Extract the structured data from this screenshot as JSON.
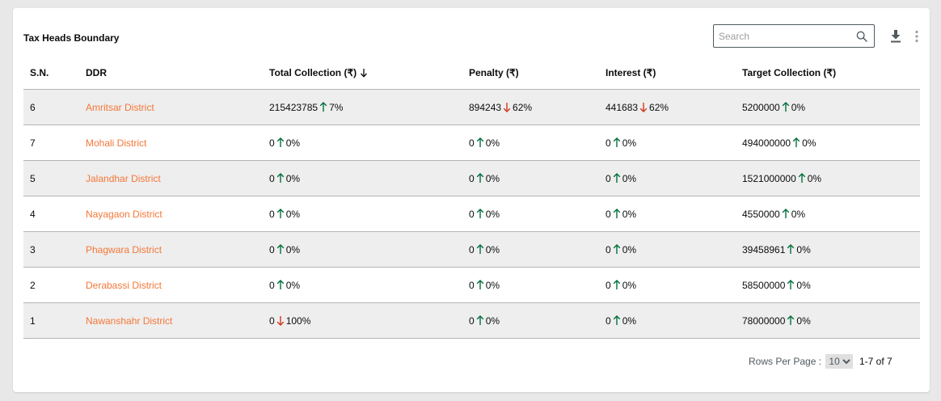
{
  "card": {
    "title": "Tax Heads Boundary",
    "search_placeholder": "Search",
    "icons": [
      "search-icon",
      "download-icon",
      "more-vertical-icon"
    ]
  },
  "table": {
    "columns": [
      "S.N.",
      "DDR",
      "Total Collection (₹)",
      "Penalty (₹)",
      "Interest (₹)",
      "Target Collection (₹)"
    ],
    "sort_column": "Total Collection (₹)",
    "sort_direction": "desc",
    "rows": [
      {
        "sn": "6",
        "ddr": "Amritsar District",
        "total": {
          "value": "215423785",
          "dir": "up",
          "pct": "7%"
        },
        "penalty": {
          "value": "894243",
          "dir": "down",
          "pct": "62%"
        },
        "interest": {
          "value": "441683",
          "dir": "down",
          "pct": "62%"
        },
        "target": {
          "value": "5200000",
          "dir": "up",
          "pct": "0%"
        }
      },
      {
        "sn": "7",
        "ddr": "Mohali District",
        "total": {
          "value": "0",
          "dir": "up",
          "pct": "0%"
        },
        "penalty": {
          "value": "0",
          "dir": "up",
          "pct": "0%"
        },
        "interest": {
          "value": "0",
          "dir": "up",
          "pct": "0%"
        },
        "target": {
          "value": "494000000",
          "dir": "up",
          "pct": "0%"
        }
      },
      {
        "sn": "5",
        "ddr": "Jalandhar District",
        "total": {
          "value": "0",
          "dir": "up",
          "pct": "0%"
        },
        "penalty": {
          "value": "0",
          "dir": "up",
          "pct": "0%"
        },
        "interest": {
          "value": "0",
          "dir": "up",
          "pct": "0%"
        },
        "target": {
          "value": "1521000000",
          "dir": "up",
          "pct": "0%"
        }
      },
      {
        "sn": "4",
        "ddr": "Nayagaon District",
        "total": {
          "value": "0",
          "dir": "up",
          "pct": "0%"
        },
        "penalty": {
          "value": "0",
          "dir": "up",
          "pct": "0%"
        },
        "interest": {
          "value": "0",
          "dir": "up",
          "pct": "0%"
        },
        "target": {
          "value": "4550000",
          "dir": "up",
          "pct": "0%"
        }
      },
      {
        "sn": "3",
        "ddr": "Phagwara District",
        "total": {
          "value": "0",
          "dir": "up",
          "pct": "0%"
        },
        "penalty": {
          "value": "0",
          "dir": "up",
          "pct": "0%"
        },
        "interest": {
          "value": "0",
          "dir": "up",
          "pct": "0%"
        },
        "target": {
          "value": "39458961",
          "dir": "up",
          "pct": "0%"
        }
      },
      {
        "sn": "2",
        "ddr": "Derabassi District",
        "total": {
          "value": "0",
          "dir": "up",
          "pct": "0%"
        },
        "penalty": {
          "value": "0",
          "dir": "up",
          "pct": "0%"
        },
        "interest": {
          "value": "0",
          "dir": "up",
          "pct": "0%"
        },
        "target": {
          "value": "58500000",
          "dir": "up",
          "pct": "0%"
        }
      },
      {
        "sn": "1",
        "ddr": "Nawanshahr District",
        "total": {
          "value": "0",
          "dir": "down",
          "pct": "100%"
        },
        "penalty": {
          "value": "0",
          "dir": "up",
          "pct": "0%"
        },
        "interest": {
          "value": "0",
          "dir": "up",
          "pct": "0%"
        },
        "target": {
          "value": "78000000",
          "dir": "up",
          "pct": "0%"
        }
      }
    ]
  },
  "pagination": {
    "rows_per_page_label": "Rows Per Page :",
    "rows_per_page_value": "10",
    "range_text": "1-7 of 7"
  },
  "colors": {
    "up": "#00703c",
    "down": "#d4351c",
    "link": "#f47738",
    "stripe": "#eeeeee"
  }
}
